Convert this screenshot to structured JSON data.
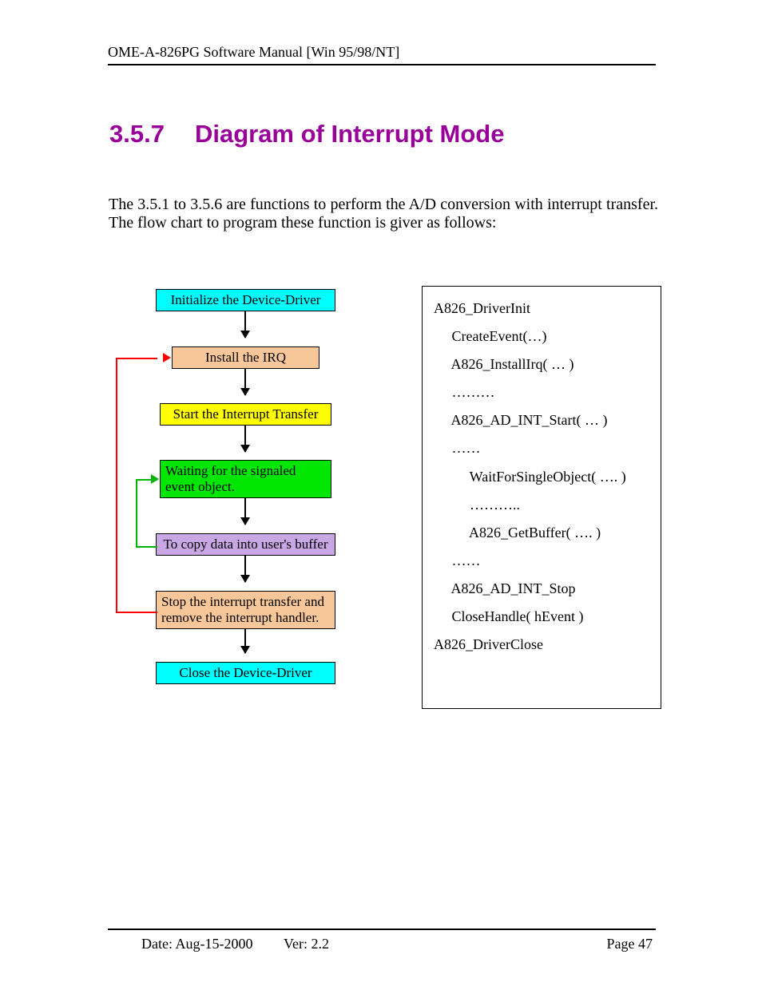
{
  "header": {
    "title": "OME-A-826PG Software Manual [Win 95/98/NT]"
  },
  "section": {
    "number": "3.5.7",
    "title": "Diagram of Interrupt Mode"
  },
  "intro": "The 3.5.1 to 3.5.6 are functions to perform the A/D conversion with interrupt transfer. The flow chart to program these function is giver as follows:",
  "flow": {
    "n1": "Initialize the Device-Driver",
    "n2": "Install the IRQ",
    "n3": "Start the Interrupt Transfer",
    "n4": "Waiting for the signaled event object.",
    "n5": "To copy data into user's buffer",
    "n6": "Stop the interrupt transfer and remove the interrupt handler.",
    "n7": "Close the Device-Driver"
  },
  "code": {
    "l1": "A826_DriverInit",
    "l2": "     CreateEvent(…)",
    "l3": "     A826_InstallIrq( … )",
    "l4": "     ………",
    "l5": "     A826_AD_INT_Start( … )",
    "l6": "     ……",
    "l7": "          WaitForSingleObject( …. )",
    "l8": "          ………..",
    "l9": "          A826_GetBuffer( …. )",
    "l10": "     ……",
    "l11": "     A826_AD_INT_Stop",
    "l12": "     CloseHandle( hEvent )",
    "l13": "A826_DriverClose"
  },
  "footer": {
    "date": "Date: Aug-15-2000",
    "ver": "Ver: 2.2",
    "page": "Page  47"
  }
}
